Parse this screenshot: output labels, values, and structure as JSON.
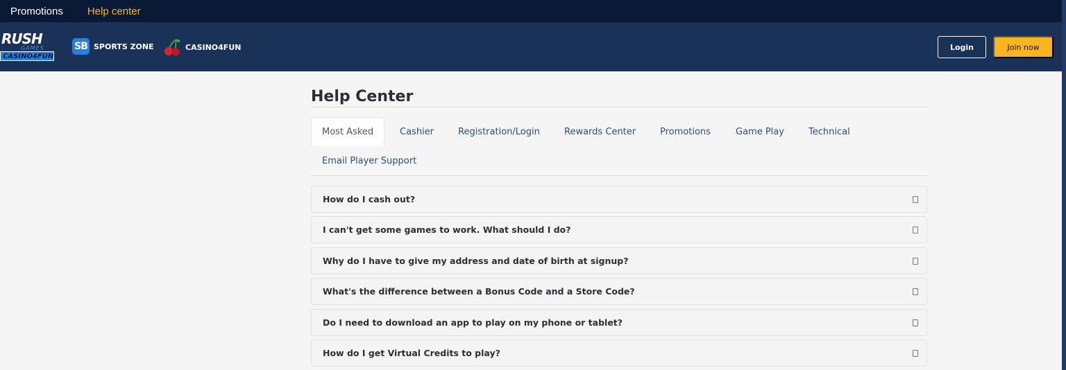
{
  "topbar": {
    "links": [
      "Promotions",
      "Help center"
    ]
  },
  "header": {
    "logo": {
      "line1": "RUSH",
      "line2": "GAMES",
      "line3": "CASINO4FUN"
    },
    "zones": [
      {
        "icon": "sb-icon",
        "icon_text": "SB",
        "label": "SPORTS ZONE"
      },
      {
        "icon": "cherry-icon",
        "label": "CASINO4FUN"
      }
    ],
    "login_label": "Login",
    "join_label": "Join now"
  },
  "colors": {
    "topbar_bg": "#0a1a36",
    "nav_bg": "#1b3258",
    "accent": "#f9b51d",
    "brand_blue": "#2a7de1"
  },
  "help": {
    "title": "Help Center",
    "tabs": [
      "Most Asked",
      "Cashier",
      "Registration/Login",
      "Rewards Center",
      "Promotions",
      "Game Play",
      "Technical",
      "Email Player Support"
    ],
    "active_tab": "Most Asked",
    "faqs": [
      "How do I cash out?",
      "I can't get some games to work. What should I do?",
      "Why do I have to give my address and date of birth at signup?",
      "What's the difference between a Bonus Code and a Store Code?",
      "Do I need to download an app to play on my phone or tablet?",
      "How do I get Virtual Credits to play?"
    ]
  }
}
